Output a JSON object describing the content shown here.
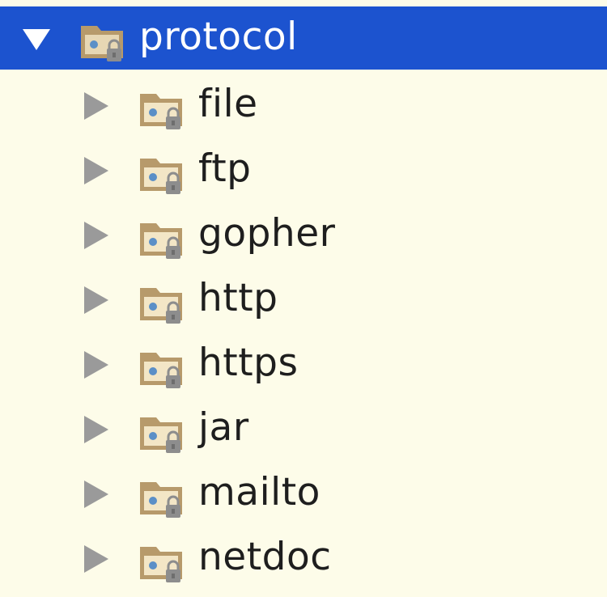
{
  "tree": {
    "root": {
      "label": "protocol",
      "expanded": true,
      "icon": "package-folder-locked-icon"
    },
    "children": [
      {
        "label": "file",
        "expanded": false,
        "icon": "package-folder-locked-icon"
      },
      {
        "label": "ftp",
        "expanded": false,
        "icon": "package-folder-locked-icon"
      },
      {
        "label": "gopher",
        "expanded": false,
        "icon": "package-folder-locked-icon"
      },
      {
        "label": "http",
        "expanded": false,
        "icon": "package-folder-locked-icon"
      },
      {
        "label": "https",
        "expanded": false,
        "icon": "package-folder-locked-icon"
      },
      {
        "label": "jar",
        "expanded": false,
        "icon": "package-folder-locked-icon"
      },
      {
        "label": "mailto",
        "expanded": false,
        "icon": "package-folder-locked-icon"
      },
      {
        "label": "netdoc",
        "expanded": false,
        "icon": "package-folder-locked-icon"
      }
    ]
  },
  "colors": {
    "background": "#fdfce9",
    "selection": "#1c53cf",
    "selected_text": "#ffffff",
    "text": "#1e1e1e",
    "arrow": "#9a9a9a",
    "folder": "#b79a6b"
  }
}
